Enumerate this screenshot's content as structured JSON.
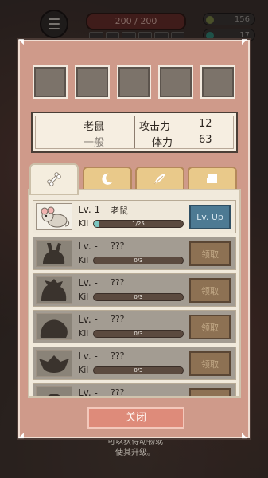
{
  "hud": {
    "hp_text": "200 / 200",
    "resource_1": "156",
    "resource_2": "17",
    "resource_1_color": "#7f8a46",
    "resource_2_color": "#2f8d7d"
  },
  "background_hint": "可以获得动物或\n使其升级。",
  "dialog": {
    "info": {
      "name": "老鼠",
      "rarity": "一般",
      "attack_label": "攻击力",
      "attack_value": "12",
      "hp_label": "体力",
      "hp_value": "63"
    },
    "tabs": [
      {
        "icon": "bone-icon",
        "active": true
      },
      {
        "icon": "crescent-icon",
        "active": false
      },
      {
        "icon": "feather-icon",
        "active": false
      },
      {
        "icon": "puzzle-icon",
        "active": false
      }
    ],
    "rows": [
      {
        "lv": "Lv. 1",
        "name": "老鼠",
        "kil": "Kil",
        "progress_text": "1/25",
        "progress": 0.04,
        "action": "Lv. Up",
        "locked": false
      },
      {
        "lv": "Lv. -",
        "name": "???",
        "kil": "Kil",
        "progress_text": "0/3",
        "progress": 0,
        "action": "领取",
        "locked": true
      },
      {
        "lv": "Lv. -",
        "name": "???",
        "kil": "Kil",
        "progress_text": "0/3",
        "progress": 0,
        "action": "领取",
        "locked": true
      },
      {
        "lv": "Lv. -",
        "name": "???",
        "kil": "Kil",
        "progress_text": "0/3",
        "progress": 0,
        "action": "领取",
        "locked": true
      },
      {
        "lv": "Lv. -",
        "name": "???",
        "kil": "Kil",
        "progress_text": "0/3",
        "progress": 0,
        "action": "领取",
        "locked": true
      },
      {
        "lv": "Lv. -",
        "name": "???",
        "kil": "",
        "progress_text": "",
        "progress": 0,
        "action": "",
        "locked": true
      }
    ],
    "close_label": "关闭"
  }
}
